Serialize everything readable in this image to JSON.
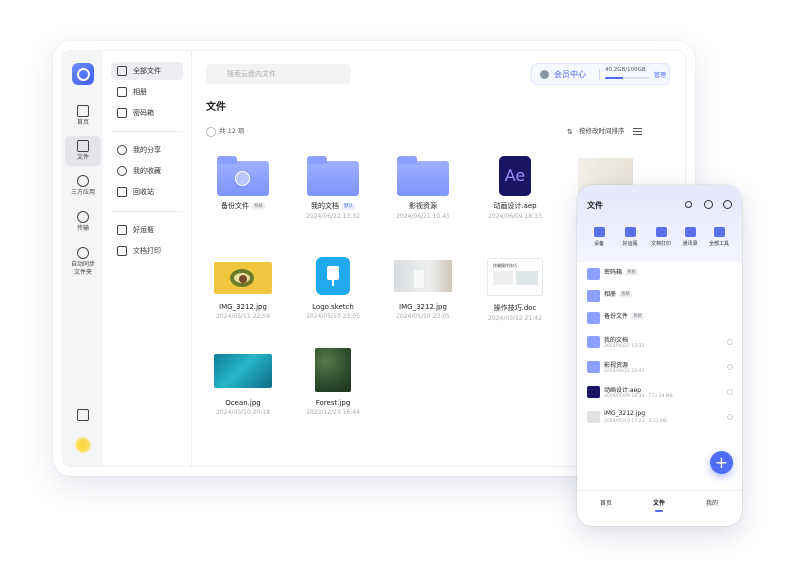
{
  "desktop": {
    "rail": [
      {
        "label": "首页",
        "icon": "home-icon"
      },
      {
        "label": "文件",
        "icon": "folder-icon"
      },
      {
        "label": "三方应用",
        "icon": "apps-icon"
      },
      {
        "label": "传输",
        "icon": "transfer-icon"
      },
      {
        "label": "自动同步\n文件夹",
        "icon": "sync-icon"
      }
    ],
    "sidebar": [
      "全部文件",
      "相册",
      "密码箱",
      "我的分享",
      "我的收藏",
      "回收站",
      "好运瓶",
      "文档打印"
    ],
    "search_placeholder": "搜索云盘内文件",
    "member_label": "会员中心",
    "storage_text": "40.2GB/100GB",
    "storage_fraction": 0.402,
    "manage_label": "管理",
    "title": "文件",
    "count": "共 12 项",
    "sort_label": "按修改时间排序",
    "files": [
      {
        "name": "备份文件",
        "tag": "系统",
        "tag_style": "gray",
        "date": "",
        "kind": "folder-shield"
      },
      {
        "name": "我的文档",
        "tag": "",
        "date": "2024/06/22 13:32",
        "kind": "folder"
      },
      {
        "name": "影视资源",
        "tag": "",
        "date": "2024/06/21 10:45",
        "kind": "folder"
      },
      {
        "name": "动画设计.aep",
        "tag": "",
        "date": "2024/06/09 18:33",
        "kind": "ae"
      },
      {
        "name": "IMG_3212.jpg",
        "tag": "",
        "date": "2024/05/11 22:59",
        "kind": "avocado"
      },
      {
        "name": "Logo.sketch",
        "tag": "",
        "date": "2024/05/10 23:05",
        "kind": "sketch"
      },
      {
        "name": "IMG_3212.jpg",
        "tag": "",
        "date": "2024/05/10 23:05",
        "kind": "room"
      },
      {
        "name": "操作技巧.doc",
        "tag": "",
        "date": "2024/03/12 21:42",
        "kind": "doc"
      },
      {
        "name": "Ocean.jpg",
        "tag": "",
        "date": "2024/03/10 20:18",
        "kind": "ocean"
      },
      {
        "name": "Forest.jpg",
        "tag": "",
        "date": "2023/12/23 16:44",
        "kind": "forest"
      }
    ],
    "badge_default": "默认",
    "doc_title": "终端操作技巧"
  },
  "mobile": {
    "title": "文件",
    "tools": [
      "设备",
      "好运瓶",
      "文档打印",
      "通讯录",
      "全部工具"
    ],
    "rows": [
      {
        "name": "密码箱",
        "tag": "系统",
        "date": ""
      },
      {
        "name": "相册",
        "tag": "系统",
        "date": ""
      },
      {
        "name": "备份文件",
        "tag": "系统",
        "date": ""
      },
      {
        "name": "我的文档",
        "tag": "",
        "date": "2024/06/22 13:32"
      },
      {
        "name": "影视资源",
        "tag": "",
        "date": "2024/06/21 10:45"
      },
      {
        "name": "动画设计.aep",
        "tag": "",
        "date": "2024/06/09 18:33 · 772.39 MB"
      },
      {
        "name": "IMG_3212.jpg",
        "tag": "",
        "date": "2024/05/19 17:23 · 1.21 MB"
      }
    ],
    "tabs": [
      "首页",
      "文件",
      "我的"
    ],
    "fab": "+"
  },
  "colors": {
    "accent": "#4f6ef5",
    "folder": "#8da0fb",
    "ae_bg": "#1b1464",
    "ae_fg": "#9c8cff"
  }
}
